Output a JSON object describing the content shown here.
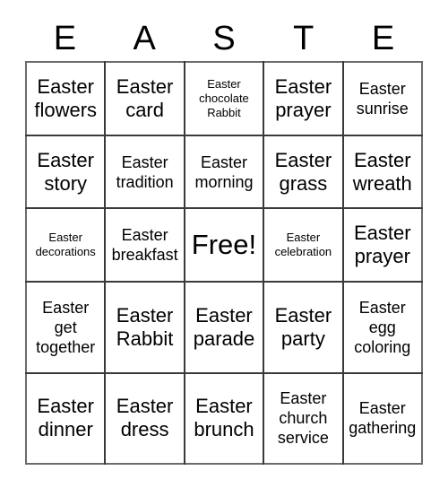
{
  "card": {
    "header_letters": [
      "E",
      "A",
      "S",
      "T",
      "E"
    ],
    "rows": [
      [
        {
          "text": "Easter flowers",
          "size": "lg"
        },
        {
          "text": "Easter card",
          "size": "lg"
        },
        {
          "text": "Easter chocolate Rabbit",
          "size": "sm"
        },
        {
          "text": "Easter prayer",
          "size": "lg"
        },
        {
          "text": "Easter sunrise",
          "size": "md"
        }
      ],
      [
        {
          "text": "Easter story",
          "size": "lg"
        },
        {
          "text": "Easter tradition",
          "size": "md"
        },
        {
          "text": "Easter morning",
          "size": "md"
        },
        {
          "text": "Easter grass",
          "size": "lg"
        },
        {
          "text": "Easter wreath",
          "size": "lg"
        }
      ],
      [
        {
          "text": "Easter decorations",
          "size": "sm"
        },
        {
          "text": "Easter breakfast",
          "size": "md"
        },
        {
          "text": "Free!",
          "size": "free"
        },
        {
          "text": "Easter celebration",
          "size": "sm"
        },
        {
          "text": "Easter prayer",
          "size": "lg"
        }
      ],
      [
        {
          "text": "Easter get together",
          "size": "md"
        },
        {
          "text": "Easter Rabbit",
          "size": "lg"
        },
        {
          "text": "Easter parade",
          "size": "lg"
        },
        {
          "text": "Easter party",
          "size": "lg"
        },
        {
          "text": "Easter egg coloring",
          "size": "md"
        }
      ],
      [
        {
          "text": "Easter dinner",
          "size": "lg"
        },
        {
          "text": "Easter dress",
          "size": "lg"
        },
        {
          "text": "Easter brunch",
          "size": "lg"
        },
        {
          "text": "Easter church service",
          "size": "md"
        },
        {
          "text": "Easter gathering",
          "size": "md"
        }
      ]
    ]
  },
  "colors": {
    "background": "#ffffff",
    "text": "#000000",
    "grid_line": "#3a3a3a",
    "grid_border": "#6b6b6b"
  }
}
